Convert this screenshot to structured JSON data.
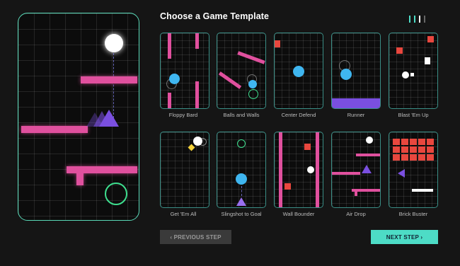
{
  "title": "Choose a Game Template",
  "step_indicator": {
    "count": 4,
    "active": 3
  },
  "templates": [
    {
      "name": "Floppy Bard"
    },
    {
      "name": "Balls and Walls"
    },
    {
      "name": "Center Defend"
    },
    {
      "name": "Runner"
    },
    {
      "name": "Blast 'Em Up"
    },
    {
      "name": "Get 'Em All"
    },
    {
      "name": "Slingshot to Goal"
    },
    {
      "name": "Wall Bounder"
    },
    {
      "name": "Air Drop"
    },
    {
      "name": "Brick Buster"
    }
  ],
  "buttons": {
    "previous": "‹ PREVIOUS STEP",
    "next": "NEXT STEP ›"
  },
  "colors": {
    "accent": "#4ddcc6",
    "card_border": "#3a8e86",
    "pink": "#e0509e",
    "cyan": "#3fb6f0",
    "red": "#e8473e",
    "purple": "#7a4fe0"
  }
}
